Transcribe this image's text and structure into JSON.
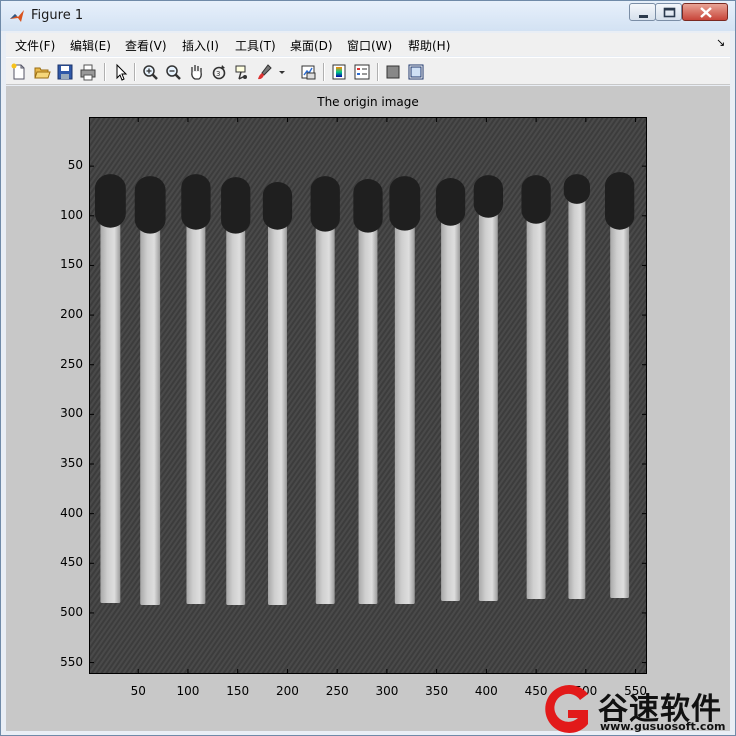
{
  "window": {
    "title": "Figure 1"
  },
  "menu": [
    {
      "id": "file",
      "label": "文件(F)"
    },
    {
      "id": "edit",
      "label": "编辑(E)"
    },
    {
      "id": "view",
      "label": "查看(V)"
    },
    {
      "id": "insert",
      "label": "插入(I)"
    },
    {
      "id": "tools",
      "label": "工具(T)"
    },
    {
      "id": "desktop",
      "label": "桌面(D)"
    },
    {
      "id": "window",
      "label": "窗口(W)"
    },
    {
      "id": "help",
      "label": "帮助(H)"
    }
  ],
  "toolbar": [
    {
      "id": "new-figure",
      "icon": "new-file-icon"
    },
    {
      "id": "open-file",
      "icon": "folder-open-icon"
    },
    {
      "id": "save-figure",
      "icon": "floppy-disk-icon"
    },
    {
      "id": "print-figure",
      "icon": "printer-icon"
    },
    {
      "id": "edit-plot",
      "icon": "arrow-pointer-icon"
    },
    {
      "id": "zoom-in",
      "icon": "zoom-in-icon"
    },
    {
      "id": "zoom-out",
      "icon": "zoom-out-icon"
    },
    {
      "id": "pan",
      "icon": "hand-icon"
    },
    {
      "id": "rotate-3d",
      "icon": "rotate-3d-icon"
    },
    {
      "id": "data-cursor",
      "icon": "data-cursor-icon"
    },
    {
      "id": "brush",
      "icon": "brush-icon"
    },
    {
      "id": "link-plot",
      "icon": "link-plot-icon"
    },
    {
      "id": "insert-colorbar",
      "icon": "colorbar-icon"
    },
    {
      "id": "insert-legend",
      "icon": "legend-icon"
    },
    {
      "id": "hide-plot-tools",
      "icon": "hide-tools-icon"
    },
    {
      "id": "show-plot-tools",
      "icon": "show-tools-icon"
    }
  ],
  "chart_data": {
    "type": "image",
    "title": "The origin image",
    "xlim": [
      0.5,
      561.5
    ],
    "ylim": [
      0.5,
      561.5
    ],
    "y_reversed": true,
    "colormap": "gray",
    "xticks": [
      50,
      100,
      150,
      200,
      250,
      300,
      350,
      400,
      450,
      500,
      550
    ],
    "xtick_labels": [
      "50",
      "100",
      "150",
      "200",
      "250",
      "300",
      "350",
      "400",
      "450",
      "500",
      "550"
    ],
    "yticks": [
      50,
      100,
      150,
      200,
      250,
      300,
      350,
      400,
      450,
      500,
      550
    ],
    "ytick_labels": [
      "50",
      "100",
      "150",
      "200",
      "250",
      "300",
      "350",
      "400",
      "450",
      "500",
      "550"
    ],
    "background_color": "#3c3c3c",
    "head_color": "#1f1f1f",
    "stick_color": "#cfcfcf",
    "matches": [
      {
        "x": 22,
        "head_top": 58,
        "head_bottom": 112,
        "stick_bottom": 490,
        "width": 20
      },
      {
        "x": 62,
        "head_top": 60,
        "head_bottom": 118,
        "stick_bottom": 492,
        "width": 20
      },
      {
        "x": 108,
        "head_top": 58,
        "head_bottom": 114,
        "stick_bottom": 491,
        "width": 19
      },
      {
        "x": 148,
        "head_top": 61,
        "head_bottom": 118,
        "stick_bottom": 492,
        "width": 19
      },
      {
        "x": 190,
        "head_top": 66,
        "head_bottom": 114,
        "stick_bottom": 492,
        "width": 19
      },
      {
        "x": 238,
        "head_top": 60,
        "head_bottom": 116,
        "stick_bottom": 491,
        "width": 19
      },
      {
        "x": 281,
        "head_top": 63,
        "head_bottom": 117,
        "stick_bottom": 491,
        "width": 19
      },
      {
        "x": 318,
        "head_top": 60,
        "head_bottom": 115,
        "stick_bottom": 491,
        "width": 20
      },
      {
        "x": 364,
        "head_top": 62,
        "head_bottom": 110,
        "stick_bottom": 488,
        "width": 19
      },
      {
        "x": 402,
        "head_top": 59,
        "head_bottom": 102,
        "stick_bottom": 488,
        "width": 19
      },
      {
        "x": 450,
        "head_top": 59,
        "head_bottom": 108,
        "stick_bottom": 486,
        "width": 19
      },
      {
        "x": 491,
        "head_top": 58,
        "head_bottom": 88,
        "stick_bottom": 486,
        "width": 17
      },
      {
        "x": 534,
        "head_top": 56,
        "head_bottom": 114,
        "stick_bottom": 485,
        "width": 19
      }
    ]
  },
  "watermark": {
    "name": "谷速软件",
    "url": "www.gusuosoft.com"
  }
}
